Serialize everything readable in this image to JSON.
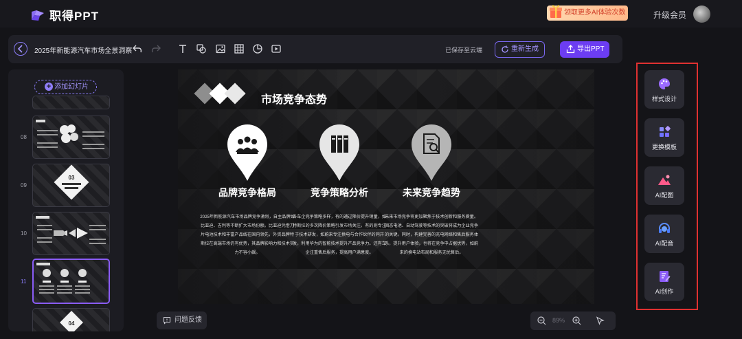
{
  "header": {
    "logo_text": "职得PPT",
    "promo_label": "领取更多AI体验次数",
    "upgrade_label": "升级会员"
  },
  "toolbar": {
    "doc_title": "2025年新能源汽车市场全景洞察",
    "saved_status": "已保存至云端",
    "regenerate_label": "重新生成",
    "export_label": "导出PPT",
    "tools": [
      "undo-icon",
      "redo-icon",
      "text-icon",
      "shape-icon",
      "image-icon",
      "table-icon",
      "chart-icon",
      "video-icon"
    ]
  },
  "sidebar": {
    "add_slide_label": "添加幻灯片",
    "slides": [
      {
        "number": "",
        "caption": ""
      },
      {
        "number": "08",
        "caption": ""
      },
      {
        "number": "09",
        "caption": "03\n消费需求与市场趋势"
      },
      {
        "number": "10",
        "caption": ""
      },
      {
        "number": "11",
        "caption": ""
      },
      {
        "number": "",
        "caption": "04"
      }
    ],
    "active_slide": "11"
  },
  "slide": {
    "title": "市场竞争态势",
    "columns": [
      {
        "icon": "team-icon",
        "title": "品牌竞争格局",
        "text": "2025年新能源汽车市场品牌竞争激烈，自主品牌如比亚迪、吉利等不断扩大市场份额。比亚迪凭借刀片电池技术和丰富产品线在国内领先，外资品牌特斯拉在高端市场仍有优势，其品牌影响力和技术实力不容小觑。"
      },
      {
        "icon": "books-icon",
        "title": "竞争策略分析",
        "text": "各车企竞争策略多样，有的通过降价提升销量，如特斯拉的多次降价策略引发市场关注。有的则专注于技术研发，如蔚来专注换电与合作伙伴的同开发，利用华为的智能技术提升产品竞争力。还有车企注重售后服务，提高用户满意度。"
      },
      {
        "icon": "document-search-icon",
        "title": "未来竞争趋势",
        "text": "未来市场竞争将更加聚焦于技术创新和服务质量。固态电池、自动驾驶等技术的突破将成为企业竞争的关键。同时，构建完善的充电网络和售后服务体系，提升用户体验，也将在竞争中占据优势，如蔚来的换电站布局和服务无忧售后。"
      }
    ]
  },
  "footer": {
    "feedback_label": "问题反馈",
    "zoom": "89%"
  },
  "right_panel": {
    "items": [
      {
        "label": "样式设计",
        "icon": "palette-icon"
      },
      {
        "label": "更换模板",
        "icon": "template-icon"
      },
      {
        "label": "AI配图",
        "icon": "ai-image-icon"
      },
      {
        "label": "AI配音",
        "icon": "ai-voice-icon"
      },
      {
        "label": "AI创作",
        "icon": "ai-write-icon"
      }
    ]
  },
  "colors": {
    "accent": "#6c3df2",
    "highlight_border": "#e03131"
  }
}
